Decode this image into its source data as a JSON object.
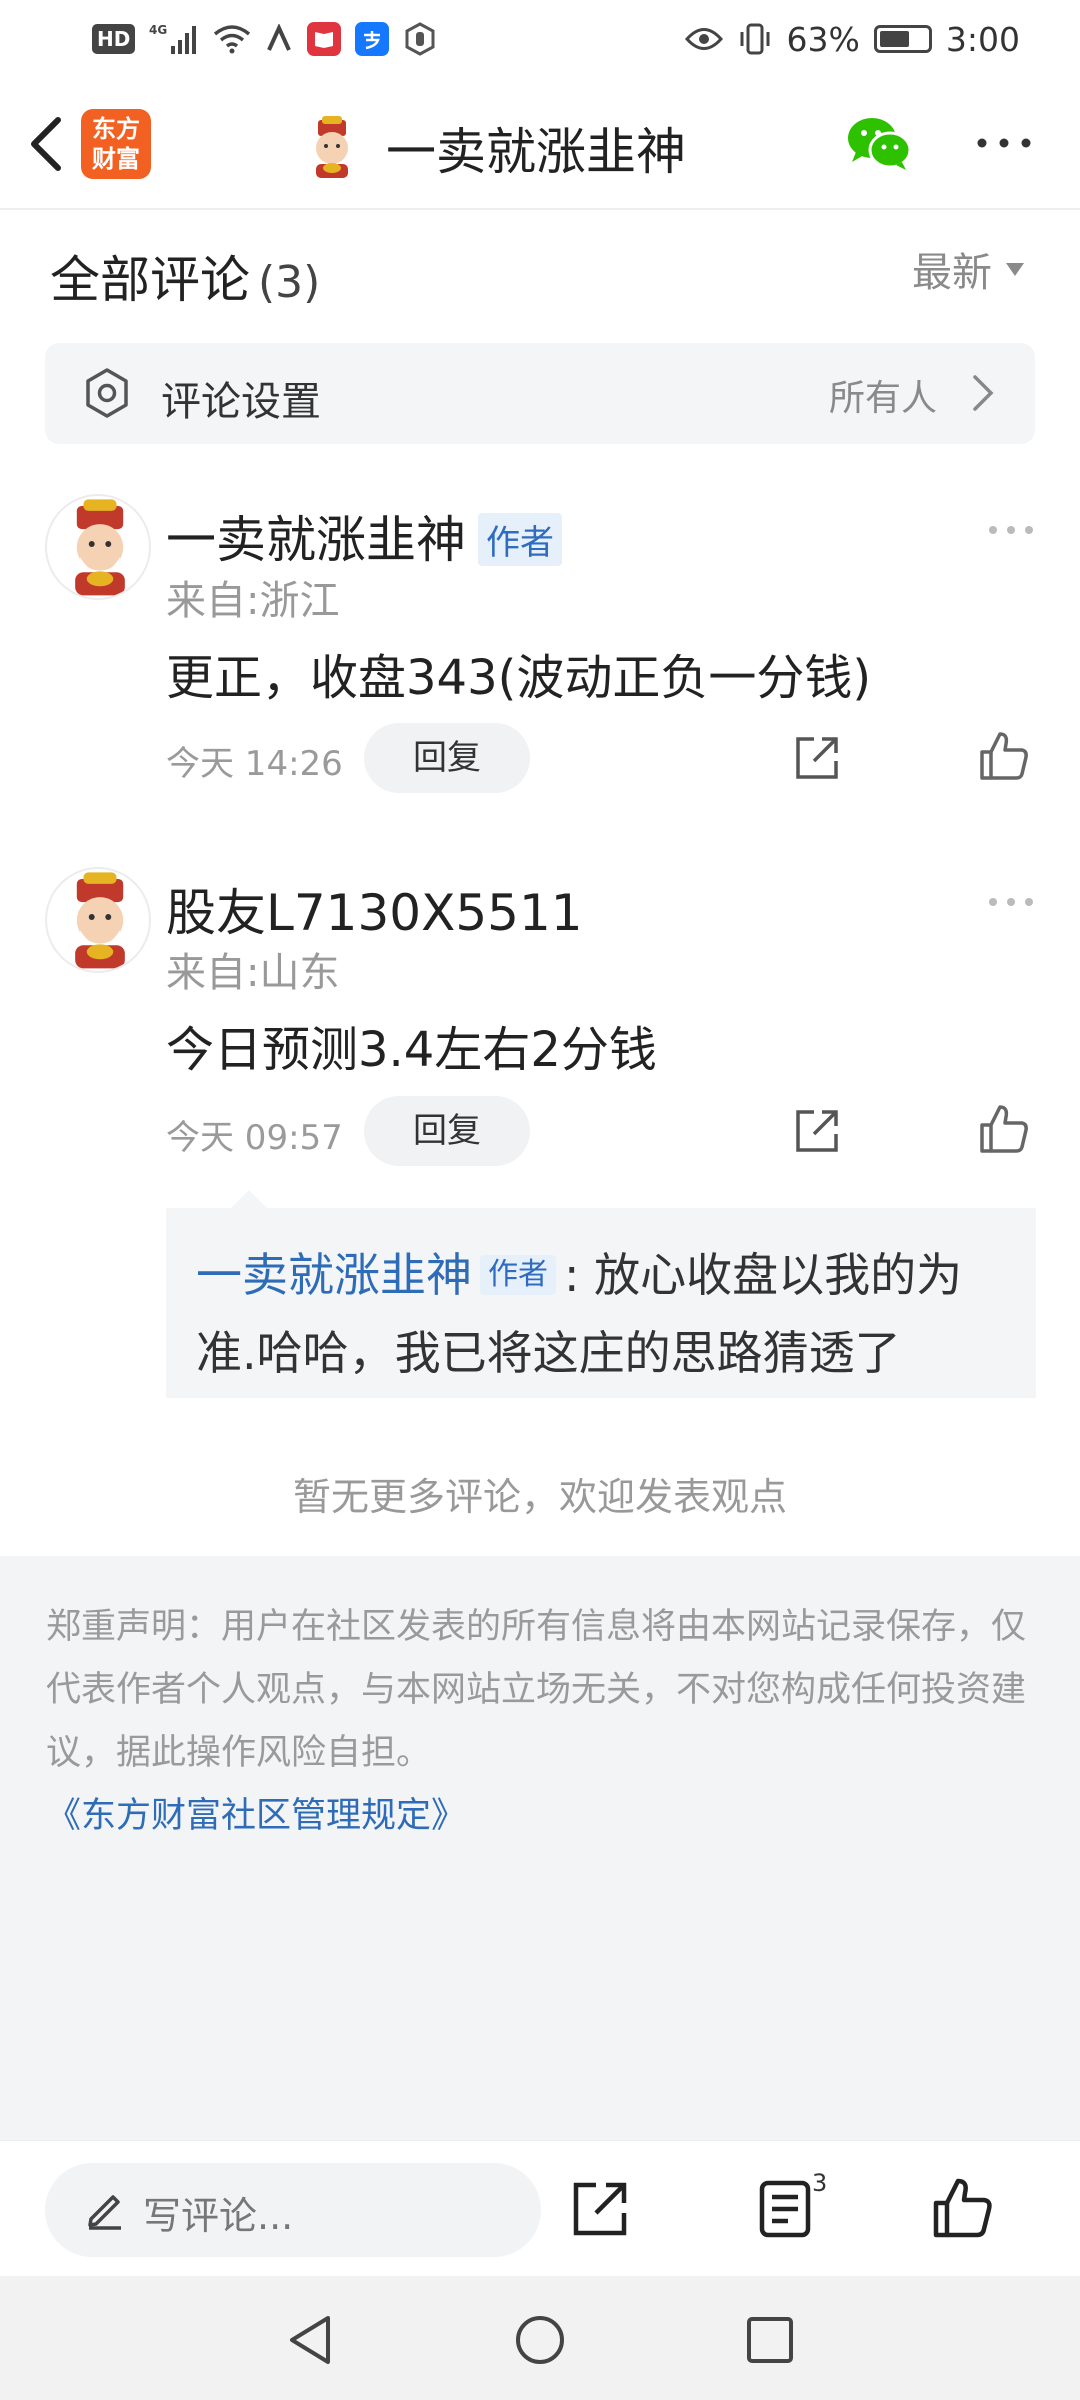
{
  "status_bar": {
    "hd": "HD",
    "network": "4G",
    "battery_percent": "63%",
    "battery_level": 0.63,
    "time": "3:00",
    "app_icon_colors": [
      "#e0353f",
      "#1677ff",
      "#555555"
    ]
  },
  "nav": {
    "logo_line1": "东方",
    "logo_line2": "财富",
    "title": "一卖就涨韭神",
    "wechat_icon": "wechat-icon",
    "more_icon": "more-icon"
  },
  "comments_header": {
    "title": "全部评论",
    "count": "(3)",
    "sort_label": "最新"
  },
  "comment_settings": {
    "label": "评论设置",
    "value": "所有人"
  },
  "comments": [
    {
      "author": "一卖就涨韭神",
      "badge": "作者",
      "location": "来自:浙江",
      "text": "更正，收盘343(波动正负一分钱)",
      "time": "今天 14:26",
      "reply_label": "回复"
    },
    {
      "author": "股友L7130X5511",
      "location": "来自:山东",
      "text": "今日预测3.4左右2分钱",
      "time": "今天 09:57",
      "reply_label": "回复",
      "sub_reply": {
        "author": "一卖就涨韭神",
        "badge": "作者",
        "text": ": 放心收盘以我的为准.哈哈，我已将这庄的思路猜透了"
      }
    }
  ],
  "no_more_text": "暂无更多评论，欢迎发表观点",
  "disclaimer": {
    "text": "郑重声明：用户在社区发表的所有信息将由本网站记录保存，仅代表作者个人观点，与本网站立场无关，不对您构成任何投资建议，据此操作风险自担。",
    "link": "《东方财富社区管理规定》"
  },
  "bottom_bar": {
    "write_placeholder": "写评论...",
    "comment_count": "3"
  },
  "colors": {
    "brand_orange": "#f26122",
    "link_blue": "#2e6cb8",
    "badge_bg": "#e6f0fb",
    "panel_gray": "#f3f4f6"
  }
}
